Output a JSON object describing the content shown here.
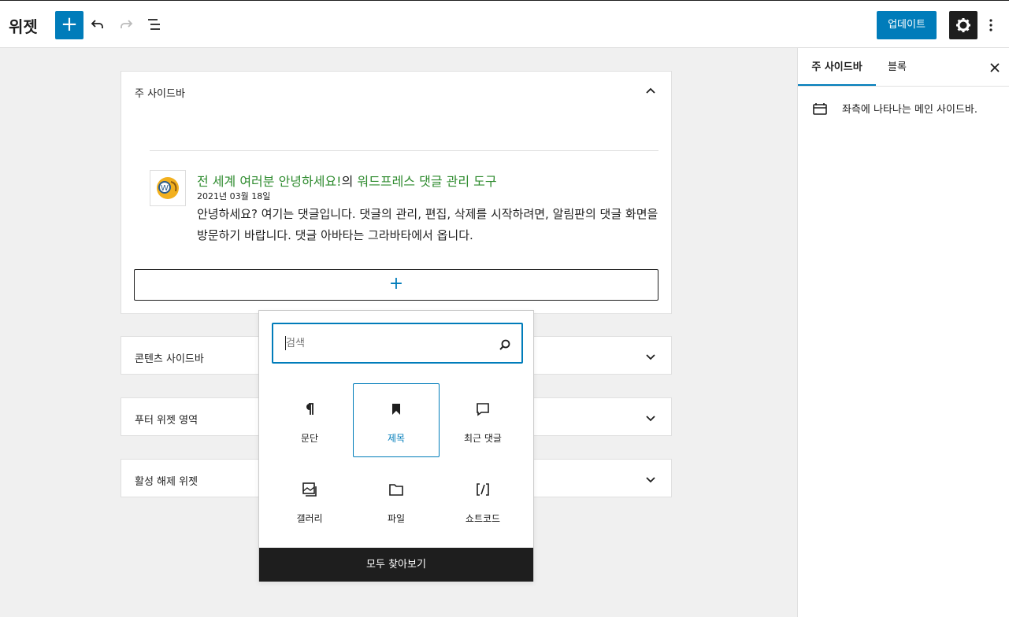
{
  "header": {
    "title": "위젯",
    "add_label": "+",
    "update_label": "업데이트"
  },
  "icons": {
    "add": "plus-icon",
    "undo": "undo-icon",
    "redo": "redo-icon",
    "list_view": "list-view-icon",
    "settings": "gear-icon",
    "more": "more-vertical-icon",
    "close": "close-icon",
    "sidebar_desc": "widget-area-icon"
  },
  "sidebar": {
    "tabs": [
      {
        "label": "주 사이드바"
      },
      {
        "label": "블록"
      }
    ],
    "description": "좌측에 나타나는 메인 사이드바."
  },
  "areas": [
    {
      "title": "주 사이드바"
    },
    {
      "title": "콘텐츠 사이드바"
    },
    {
      "title": "푸터 위젯 영역"
    },
    {
      "title": "활성 해제 위젯"
    }
  ],
  "comment": {
    "author_link": "전 세계 여러분 안녕하세요!",
    "of": "의",
    "post_link": "워드프레스 댓글 관리 도구",
    "date": "2021년 03월 18일",
    "text": "안녕하세요? 여기는 댓글입니다. 댓글의 관리, 편집, 삭제를 시작하려면, 알림판의 댓글 화면을 방문하기 바랍니다. 댓글 아바타는 그라바타에서 옵니다."
  },
  "add_block_label": "+",
  "inserter": {
    "search_placeholder": "검색",
    "blocks": [
      {
        "label": "문단",
        "icon": "paragraph-icon"
      },
      {
        "label": "제목",
        "icon": "heading-bookmark-icon"
      },
      {
        "label": "최근 댓글",
        "icon": "comment-icon"
      },
      {
        "label": "갤러리",
        "icon": "gallery-icon"
      },
      {
        "label": "파일",
        "icon": "folder-icon"
      },
      {
        "label": "쇼트코드",
        "icon": "shortcode-icon"
      }
    ],
    "browse_all": "모두 찾아보기"
  },
  "colors": {
    "accent": "#007cba",
    "dark": "#1e1e1e",
    "link": "#2e8b2e",
    "background": "#f0f0f0"
  }
}
